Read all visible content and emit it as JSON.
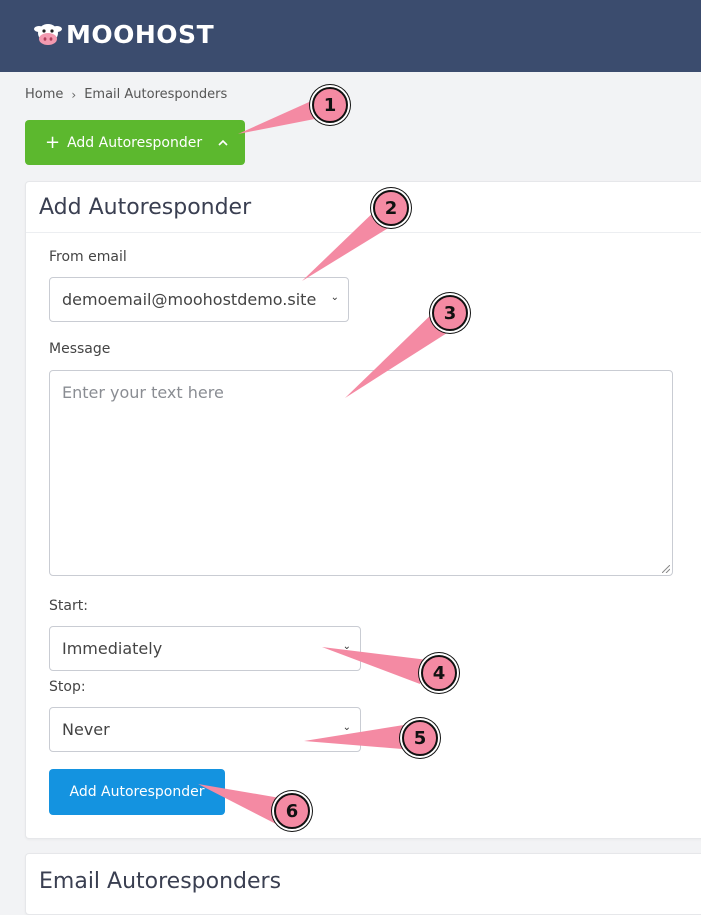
{
  "header": {
    "brand": "MOOHOST",
    "logo_icon": "cow-face-icon",
    "bg": "#3b4c6e"
  },
  "breadcrumb": {
    "home": "Home",
    "current": "Email Autoresponders",
    "separator_icon": "chevron-right-icon"
  },
  "top_button": {
    "plus": "+",
    "label": "Add Autoresponder",
    "chevron": "^",
    "color": "#5cb82e"
  },
  "form_card": {
    "title": "Add Autoresponder",
    "from_label": "From email",
    "from_value": "demoemail@moohostdemo.site",
    "message_label": "Message",
    "message_placeholder": "Enter your text here",
    "start_label": "Start:",
    "start_value": "Immediately",
    "stop_label": "Stop:",
    "stop_value": "Never",
    "submit_label": "Add Autoresponder",
    "submit_color": "#1493e0"
  },
  "list_card": {
    "title": "Email Autoresponders"
  },
  "callouts": [
    "1",
    "2",
    "3",
    "4",
    "5",
    "6"
  ],
  "callout_color": "#f48aa3"
}
